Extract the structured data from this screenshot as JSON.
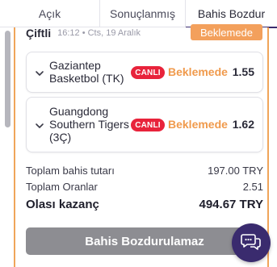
{
  "tabs": [
    {
      "label": "Açık"
    },
    {
      "label": "Sonuçlanmış"
    },
    {
      "label": "Bahis Bozdur"
    }
  ],
  "bet": {
    "type": "Çiftli",
    "date": "16:12 • Cts, 19 Aralık",
    "status": "Beklemede"
  },
  "selections": [
    {
      "name": "Gaziantep Basketbol (TK)",
      "live_label": "CANLI",
      "status": "Beklemede",
      "odds": "1.55"
    },
    {
      "name": "Guangdong Southern Tigers (3Ç)",
      "live_label": "CANLI",
      "status": "Beklemede",
      "odds": "1.62"
    }
  ],
  "totals": {
    "stake_label": "Toplam bahis tutarı",
    "stake_value": "197.00 TRY",
    "odds_label": "Toplam Oranlar",
    "odds_value": "2.51",
    "win_label": "Olası kazanç",
    "win_value": "494.67 TRY"
  },
  "cashout_button": "Bahis Bozdurulamaz",
  "colors": {
    "accent": "#3a2b6e",
    "pending": "#f3a05c",
    "live": "#e8233b",
    "disabled_button": "#8d8d92"
  },
  "icons": [
    "chevron-down-icon",
    "chat-icon"
  ]
}
